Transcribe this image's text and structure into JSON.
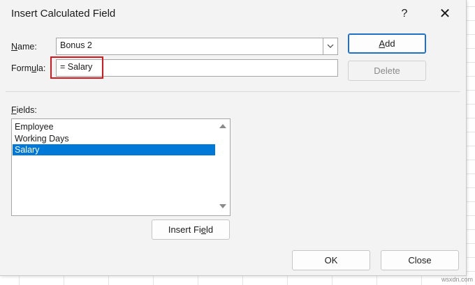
{
  "dialog": {
    "title": "Insert Calculated Field",
    "help_label": "?",
    "close_label": "✕"
  },
  "name_field": {
    "label_prefix": "N",
    "label_rest": "ame:",
    "value": "Bonus 2"
  },
  "formula_field": {
    "label_prefix": "Form",
    "label_hotkey": "u",
    "label_rest": "la:",
    "value": "= Salary"
  },
  "buttons": {
    "add_hotkey": "A",
    "add_rest": "dd",
    "delete_label": "Delete",
    "insert_field_prefix": "Insert Fi",
    "insert_field_hotkey": "e",
    "insert_field_rest": "ld",
    "ok_label": "OK",
    "close_label": "Close"
  },
  "fields": {
    "label_hotkey": "F",
    "label_rest": "ields:",
    "items": [
      "Employee",
      "Working Days",
      "Salary"
    ],
    "selected": "Salary"
  },
  "colors": {
    "selection": "#0078d7",
    "highlight": "#d9141b",
    "default_button_border": "#1f6fc4"
  },
  "watermark": "wsxdn.com"
}
